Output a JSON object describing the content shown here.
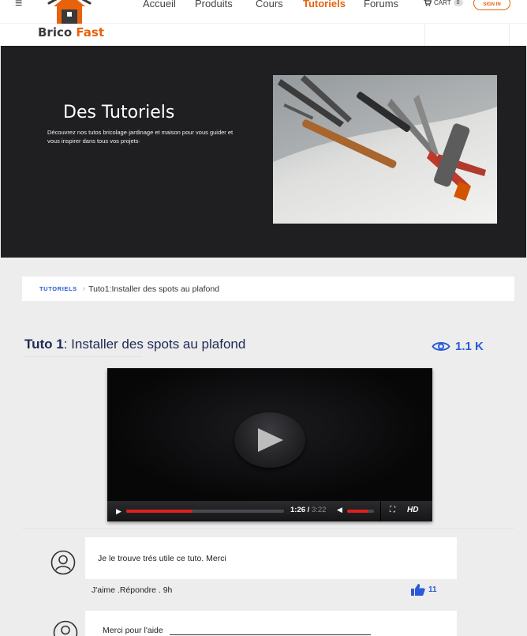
{
  "header": {
    "logo": {
      "brand_dark": "Brico",
      "brand_accent": "Fast"
    },
    "nav": [
      {
        "label": "Accueil"
      },
      {
        "label": "Produits"
      },
      {
        "label": "Cours"
      },
      {
        "label": "Tutoriels"
      },
      {
        "label": "Forums"
      }
    ],
    "active_nav": "Tutoriels",
    "cart": {
      "label": "CART",
      "count": "0"
    },
    "signin_label": "SIGN IN"
  },
  "hero": {
    "title": "Des Tutoriels",
    "subtitle": "Découvrez nos tutos bricolage·jardinage et maison pour vous guider et vous inspirer dans tous vos projets·"
  },
  "breadcrumb": {
    "root": "TUTORIELS",
    "current": "Tuto1:Installer des spots au plafond"
  },
  "tutorial": {
    "title_bold": "Tuto 1",
    "title_rest": ": Installer des spots au plafond",
    "views": "1.1 K"
  },
  "video": {
    "current_time": "1:26",
    "separator": "/",
    "duration": "3:22",
    "hd_label": "HD",
    "progress_fraction": 0.42,
    "volume_fraction": 0.8
  },
  "comments": [
    {
      "text": "Je le trouve trés utile ce tuto. Merci",
      "meta": "J'aime  .Répondre  .  9h",
      "likes": "11"
    },
    {
      "text": "Merci pour l'aide"
    }
  ],
  "colors": {
    "accent": "#e8620c",
    "link": "#2a5bd7",
    "hero_bg": "#1f1f21"
  }
}
